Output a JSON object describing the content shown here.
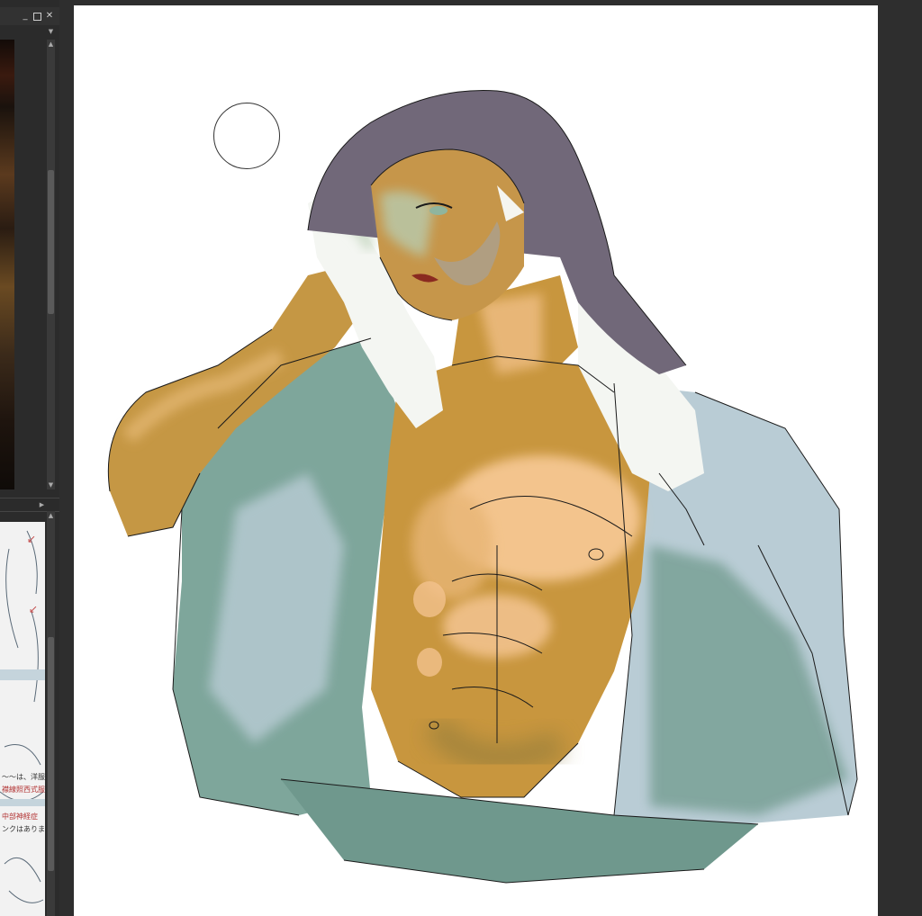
{
  "window": {
    "minimize_icon": "minimize-icon",
    "maximize_icon": "maximize-icon",
    "close_icon": "close-icon"
  },
  "reference_panel": {
    "text_lines": [
      "〜〜は、洋服とは",
      "襟線照西式服",
      "中部神経症",
      "ンクはありま"
    ]
  },
  "canvas": {
    "background": "#ffffff",
    "colors": {
      "skin": "#c89a4a",
      "skin_light": "#f2c28d",
      "shirt": "#6f9a8e",
      "shirt_light": "#b8cdd6",
      "towel": "#f4f6f2",
      "hair": "#6f6677",
      "lineart": "#1a1a1a"
    }
  }
}
